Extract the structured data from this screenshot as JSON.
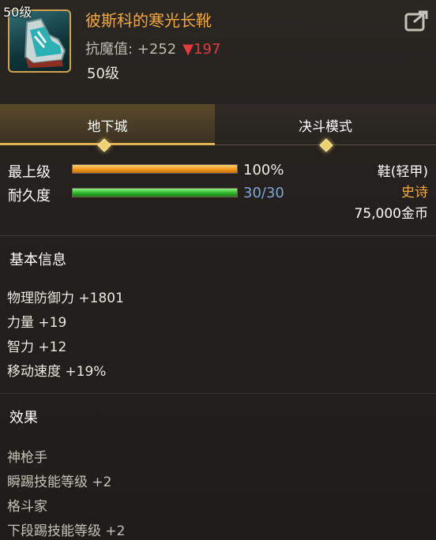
{
  "header": {
    "icon_level": "50级",
    "item_name": "彼斯科的寒光长靴",
    "resist_label": "抗魔值: +252",
    "resist_diff": "▼197",
    "item_level": "50级"
  },
  "tabs": [
    {
      "label": "地下城",
      "active": true
    },
    {
      "label": "决斗模式",
      "active": false
    }
  ],
  "stats": {
    "upgrade_label": "最上级",
    "upgrade_pct": "100%",
    "upgrade_fraction": 1.0,
    "durability_label": "耐久度",
    "durability_value": "30/30",
    "durability_fraction": 1.0
  },
  "item_info": {
    "slot_type": "鞋(轻甲)",
    "rarity": "史诗",
    "price": "75,000金币"
  },
  "basic_info": {
    "title": "基本信息",
    "lines": [
      "物理防御力 +1801",
      "力量 +19",
      "智力 +12",
      "移动速度 +19%"
    ]
  },
  "effects": {
    "title": "效果",
    "lines": [
      "神枪手",
      "瞬踢技能等级 +2",
      "格斗家",
      "下段踢技能等级 +2"
    ]
  },
  "colors": {
    "accent": "#f2a93b",
    "decrease": "#e23b3b",
    "durability": "#7da5d6"
  }
}
